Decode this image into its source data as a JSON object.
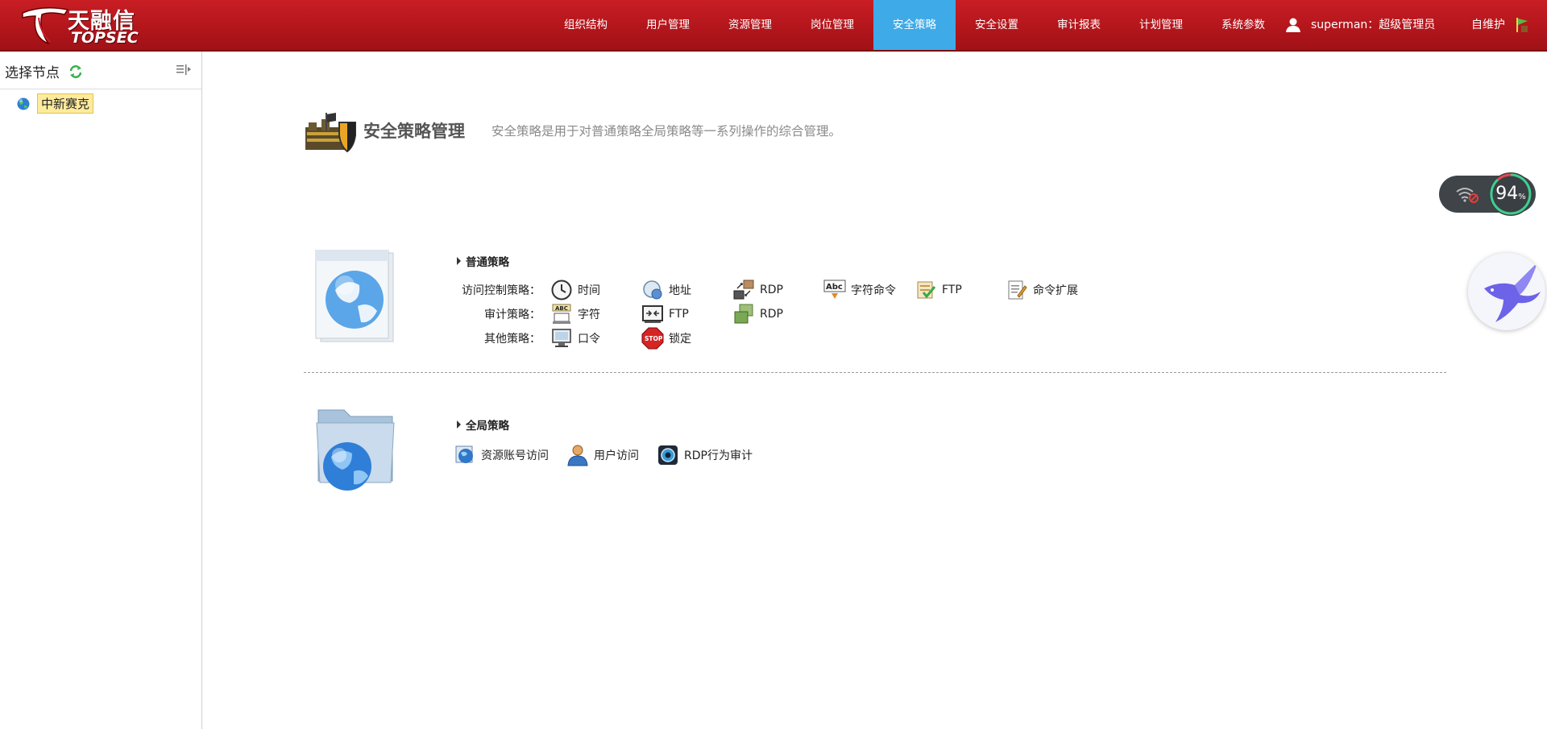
{
  "header": {
    "logo_cn": "天融信",
    "logo_en": "TOPSEC",
    "nav": [
      {
        "label": "组织结构"
      },
      {
        "label": "用户管理"
      },
      {
        "label": "资源管理"
      },
      {
        "label": "岗位管理"
      },
      {
        "label": "安全策略",
        "active": true
      },
      {
        "label": "安全设置"
      },
      {
        "label": "审计报表"
      },
      {
        "label": "计划管理"
      },
      {
        "label": "系统参数"
      }
    ],
    "user_label": "superman：超级管理员",
    "self_maint": "自维护"
  },
  "sidebar": {
    "title": "选择节点",
    "tree_root": "中新赛克"
  },
  "page": {
    "title": "安全策略管理",
    "description": "安全策略是用于对普通策略全局策略等一系列操作的综合管理。"
  },
  "normal_policy": {
    "heading": "普通策略",
    "rows": [
      {
        "label": "访问控制策略：",
        "items": [
          "时间",
          "地址",
          "RDP",
          "字符命令",
          "FTP",
          "命令扩展"
        ]
      },
      {
        "label": "审计策略：",
        "items": [
          "字符",
          "FTP",
          "RDP"
        ]
      },
      {
        "label": "其他策略：",
        "items": [
          "口令",
          "锁定"
        ]
      }
    ]
  },
  "global_policy": {
    "heading": "全局策略",
    "items": [
      "资源账号访问",
      "用户访问",
      "RDP行为审计"
    ]
  },
  "widget": {
    "net_percent": "94",
    "pct_sign": "%"
  },
  "colors": {
    "header_red": "#b3161c",
    "active_tab": "#3eaae8",
    "node_highlight": "#ffeb9c"
  }
}
